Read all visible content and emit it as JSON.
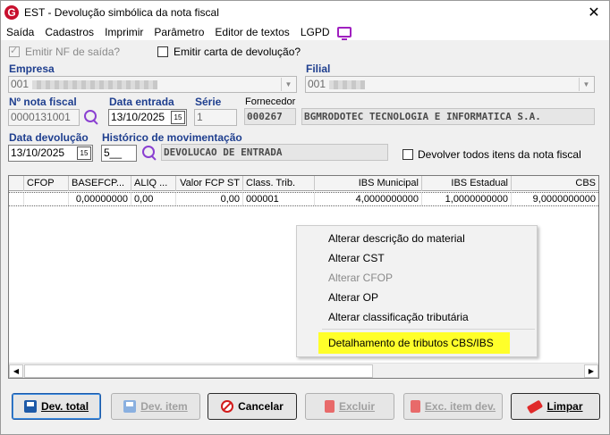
{
  "window": {
    "title": "EST - Devolução simbólica da nota fiscal",
    "app_icon": "G"
  },
  "menu": [
    "Saída",
    "Cadastros",
    "Imprimir",
    "Parâmetro",
    "Editor de textos",
    "LGPD"
  ],
  "options": {
    "emitir_nf": "Emitir NF de saída?",
    "emitir_carta": "Emitir carta de devolução?"
  },
  "empresa": {
    "label": "Empresa",
    "value": "001"
  },
  "filial": {
    "label": "Filial",
    "value": "001"
  },
  "nota": {
    "label": "Nº nota fiscal",
    "value": "0000131001"
  },
  "data_entrada": {
    "label": "Data entrada",
    "value": "13/10/2025"
  },
  "serie": {
    "label": "Série",
    "value": "1"
  },
  "fornecedor": {
    "label": "Fornecedor",
    "code": "000267",
    "name": "BGMRODOTEC TECNOLOGIA E INFORMATICA S.A."
  },
  "data_devolucao": {
    "label": "Data devolução",
    "value": "13/10/2025"
  },
  "historico": {
    "label": "Histórico de movimentação",
    "code": "5__",
    "description": "DEVOLUCAO DE ENTRADA"
  },
  "devolver_todos": "Devolver todos itens da nota fiscal",
  "table": {
    "columns": [
      "",
      "CFOP",
      "BASEFCP...",
      "ALIQ ...",
      "Valor FCP ST",
      "Class. Trib.",
      "IBS Municipal",
      "IBS Estadual",
      "CBS"
    ],
    "rows": [
      [
        "",
        "",
        "0,00000000",
        "0,00",
        "0,00",
        "000001",
        "4,0000000000",
        "1,0000000000",
        "9,0000000000"
      ]
    ]
  },
  "context_menu": {
    "items": [
      {
        "label": "Alterar descrição do material",
        "enabled": true
      },
      {
        "label": "Alterar CST",
        "enabled": true
      },
      {
        "label": "Alterar CFOP",
        "enabled": false
      },
      {
        "label": "Alterar OP",
        "enabled": true
      },
      {
        "label": "Alterar classificação tributária",
        "enabled": true
      }
    ],
    "highlighted": "Detalhamento de tributos CBS/IBS"
  },
  "buttons": {
    "dev_total": "Dev. total",
    "dev_item": "Dev. item",
    "cancelar": "Cancelar",
    "excluir": "Excluir",
    "exc_item": "Exc. item dev.",
    "limpar": "Limpar"
  },
  "colors": {
    "label_blue": "#1f3f8f",
    "highlight": "#ffff2a",
    "search_purple": "#8a3fd1"
  }
}
